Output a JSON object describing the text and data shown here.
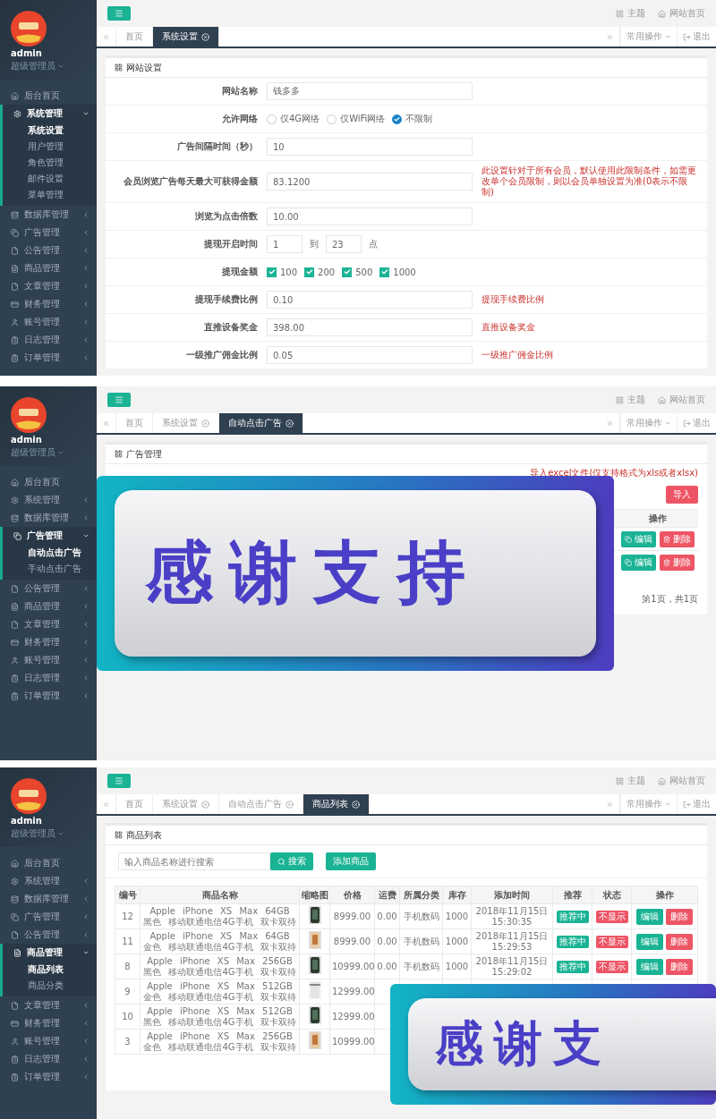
{
  "screens": [
    {
      "kind": "settings",
      "sidebar": {
        "user": "admin",
        "role": "超级管理员",
        "items": [
          {
            "kind": "link",
            "label": "后台首页"
          },
          {
            "kind": "group",
            "label": "系统管理",
            "expanded": true,
            "children": [
              {
                "label": "系统设置",
                "selected": true
              },
              {
                "label": "用户管理",
                "selected": false
              },
              {
                "label": "角色管理",
                "selected": false
              },
              {
                "label": "邮件设置",
                "selected": false
              },
              {
                "label": "菜单管理",
                "selected": false
              }
            ]
          },
          {
            "kind": "group",
            "label": "数据库管理",
            "expanded": false
          },
          {
            "kind": "group",
            "label": "广告管理",
            "expanded": false
          },
          {
            "kind": "group",
            "label": "公告管理",
            "expanded": false
          },
          {
            "kind": "group",
            "label": "商品管理",
            "expanded": false
          },
          {
            "kind": "group",
            "label": "文章管理",
            "expanded": false
          },
          {
            "kind": "group",
            "label": "财务管理",
            "expanded": false
          },
          {
            "kind": "group",
            "label": "账号管理",
            "expanded": false
          },
          {
            "kind": "group",
            "label": "日志管理",
            "expanded": false
          },
          {
            "kind": "group",
            "label": "订单管理",
            "expanded": false
          }
        ]
      },
      "topbar": {
        "links": [
          "主题",
          "网站首页"
        ]
      },
      "nav": {
        "tabs": [
          {
            "label": "首页",
            "selected": false,
            "closable": false
          },
          {
            "label": "系统设置",
            "selected": true,
            "closable": true
          }
        ],
        "actions": "常用操作",
        "logout": "退出"
      },
      "title": "网站设置",
      "rows": [
        {
          "kind": "text",
          "label": "网站名称",
          "value": "钱多多"
        },
        {
          "kind": "radio",
          "label": "允许网络",
          "options": [
            {
              "label": "仅4G网络",
              "selected": false
            },
            {
              "label": "仅WiFi网络",
              "selected": false
            },
            {
              "label": "不限制",
              "selected": true
            }
          ]
        },
        {
          "kind": "text",
          "label": "广告间隔时间（秒）",
          "value": "10"
        },
        {
          "kind": "text",
          "label": "会员浏览广告每天最大可获得金额",
          "value": "83.1200",
          "note": "此设置针对于所有会员，默认使用此限制条件，如需更改单个会员限制，则以会员单独设置为准(0表示不限制)"
        },
        {
          "kind": "text",
          "label": "浏览为点击倍数",
          "value": "10.00"
        },
        {
          "kind": "range",
          "label": "提现开启时间",
          "from": "1",
          "separator": "到",
          "to": "23",
          "unit": "点"
        },
        {
          "kind": "checkbox",
          "label": "提现金额",
          "options": [
            {
              "label": "100",
              "checked": true
            },
            {
              "label": "200",
              "checked": true
            },
            {
              "label": "500",
              "checked": true
            },
            {
              "label": "1000",
              "checked": true
            }
          ]
        },
        {
          "kind": "text",
          "label": "提现手续费比例",
          "value": "0.10",
          "note": "提现手续费比例"
        },
        {
          "kind": "text",
          "label": "直推设备奖金",
          "value": "398.00",
          "note": "直推设备奖金"
        },
        {
          "kind": "text",
          "label": "一级推广佣金比例",
          "value": "0.05",
          "note": "一级推广佣金比例"
        }
      ]
    },
    {
      "kind": "ad_list",
      "sidebar": {
        "user": "admin",
        "role": "超级管理员",
        "items": [
          {
            "kind": "link",
            "label": "后台首页"
          },
          {
            "kind": "group",
            "label": "系统管理",
            "expanded": false
          },
          {
            "kind": "group",
            "label": "数据库管理",
            "expanded": false
          },
          {
            "kind": "group",
            "label": "广告管理",
            "expanded": true,
            "children": [
              {
                "label": "自动点击广告",
                "selected": true
              },
              {
                "label": "手动点击广告",
                "selected": false
              }
            ]
          },
          {
            "kind": "group",
            "label": "公告管理",
            "expanded": false
          },
          {
            "kind": "group",
            "label": "商品管理",
            "expanded": false
          },
          {
            "kind": "group",
            "label": "文章管理",
            "expanded": false
          },
          {
            "kind": "group",
            "label": "财务管理",
            "expanded": false
          },
          {
            "kind": "group",
            "label": "账号管理",
            "expanded": false
          },
          {
            "kind": "group",
            "label": "日志管理",
            "expanded": false
          },
          {
            "kind": "group",
            "label": "订单管理",
            "expanded": false
          }
        ]
      },
      "topbar": {
        "links": [
          "主题",
          "网站首页"
        ]
      },
      "nav": {
        "tabs": [
          {
            "label": "首页",
            "selected": false,
            "closable": false
          },
          {
            "label": "系统设置",
            "selected": false,
            "closable": true
          },
          {
            "label": "自动点击广告",
            "selected": true,
            "closable": true
          }
        ],
        "actions": "常用操作",
        "logout": "退出"
      },
      "title": "广告管理",
      "import_note": "导入excel文件(仅支持格式为xls或者xlsx)",
      "import_button": "导入",
      "table": {
        "columns": [
          "操作"
        ],
        "rows": [
          {
            "actions": [
              "编辑",
              "删除"
            ]
          },
          {
            "actions": [
              "编辑",
              "删除"
            ]
          }
        ]
      },
      "pagination": "第1页，共1页",
      "overlay": "感谢支持"
    },
    {
      "kind": "product_list",
      "sidebar": {
        "user": "admin",
        "role": "超级管理员",
        "items": [
          {
            "kind": "link",
            "label": "后台首页"
          },
          {
            "kind": "group",
            "label": "系统管理",
            "expanded": false
          },
          {
            "kind": "group",
            "label": "数据库管理",
            "expanded": false
          },
          {
            "kind": "group",
            "label": "广告管理",
            "expanded": false
          },
          {
            "kind": "group",
            "label": "公告管理",
            "expanded": false
          },
          {
            "kind": "group",
            "label": "商品管理",
            "expanded": true,
            "children": [
              {
                "label": "商品列表",
                "selected": true
              },
              {
                "label": "商品分类",
                "selected": false
              }
            ]
          },
          {
            "kind": "group",
            "label": "文章管理",
            "expanded": false
          },
          {
            "kind": "group",
            "label": "财务管理",
            "expanded": false
          },
          {
            "kind": "group",
            "label": "账号管理",
            "expanded": false
          },
          {
            "kind": "group",
            "label": "日志管理",
            "expanded": false
          },
          {
            "kind": "group",
            "label": "订单管理",
            "expanded": false
          }
        ]
      },
      "topbar": {
        "links": [
          "主题",
          "网站首页"
        ]
      },
      "nav": {
        "tabs": [
          {
            "label": "首页",
            "selected": false,
            "closable": false
          },
          {
            "label": "系统设置",
            "selected": false,
            "closable": true
          },
          {
            "label": "自动点击广告",
            "selected": false,
            "closable": true
          },
          {
            "label": "商品列表",
            "selected": true,
            "closable": true
          }
        ],
        "actions": "常用操作",
        "logout": "退出"
      },
      "title": "商品列表",
      "search": {
        "placeholder": "输入商品名称进行搜索",
        "button": "搜索"
      },
      "add_button": "添加商品",
      "table": {
        "columns": [
          "编号",
          "商品名称",
          "缩略图",
          "价格",
          "运费",
          "所属分类",
          "库存",
          "添加时间",
          "推荐",
          "状态",
          "操作"
        ],
        "rows": [
          {
            "id": "12",
            "name": "Apple iPhone XS Max 64GB 黑色 移动联通电信4G手机 双卡双待",
            "thumbnail": {
              "kind": "picture"
            },
            "price": "8999.00",
            "shipping": "0.00",
            "category": "手机数码",
            "stock": "1000",
            "added": "2018年11月15日 15:30:35",
            "recommend": "推荐中",
            "status": "不显示",
            "actions": [
              "编辑",
              "删除"
            ]
          },
          {
            "id": "11",
            "name": "Apple iPhone XS Max 64GB 金色 移动联通电信4G手机 双卡双待",
            "thumbnail": {
              "kind": "picture"
            },
            "price": "8999.00",
            "shipping": "0.00",
            "category": "手机数码",
            "stock": "1000",
            "added": "2018年11月15日 15:29:53",
            "recommend": "推荐中",
            "status": "不显示",
            "actions": [
              "编辑",
              "删除"
            ]
          },
          {
            "id": "8",
            "name": "Apple iPhone XS Max 256GB 黑色 移动联通电信4G手机 双卡双待",
            "thumbnail": {
              "kind": "picture"
            },
            "price": "10999.00",
            "shipping": "0.00",
            "category": "手机数码",
            "stock": "1000",
            "added": "2018年11月15日 15:29:02",
            "recommend": "推荐中",
            "status": "不显示",
            "actions": [
              "编辑",
              "删除"
            ]
          },
          {
            "id": "9",
            "name": "Apple iPhone XS Max 512GB 金色 移动联通电信4G手机 双卡双待",
            "thumbnail": {
              "kind": "picture"
            },
            "price": "12999.00"
          },
          {
            "id": "10",
            "name": "Apple iPhone XS Max 512GB 黑色 移动联通电信4G手机 双卡双待",
            "thumbnail": {
              "kind": "picture"
            },
            "price": "12999.00"
          },
          {
            "id": "3",
            "name": "Apple iPhone XS Max 256GB 金色 移动联通电信4G手机 双卡双待",
            "thumbnail": {
              "kind": "picture"
            },
            "price": "10999.00"
          }
        ]
      },
      "overlay": "感谢支"
    }
  ]
}
